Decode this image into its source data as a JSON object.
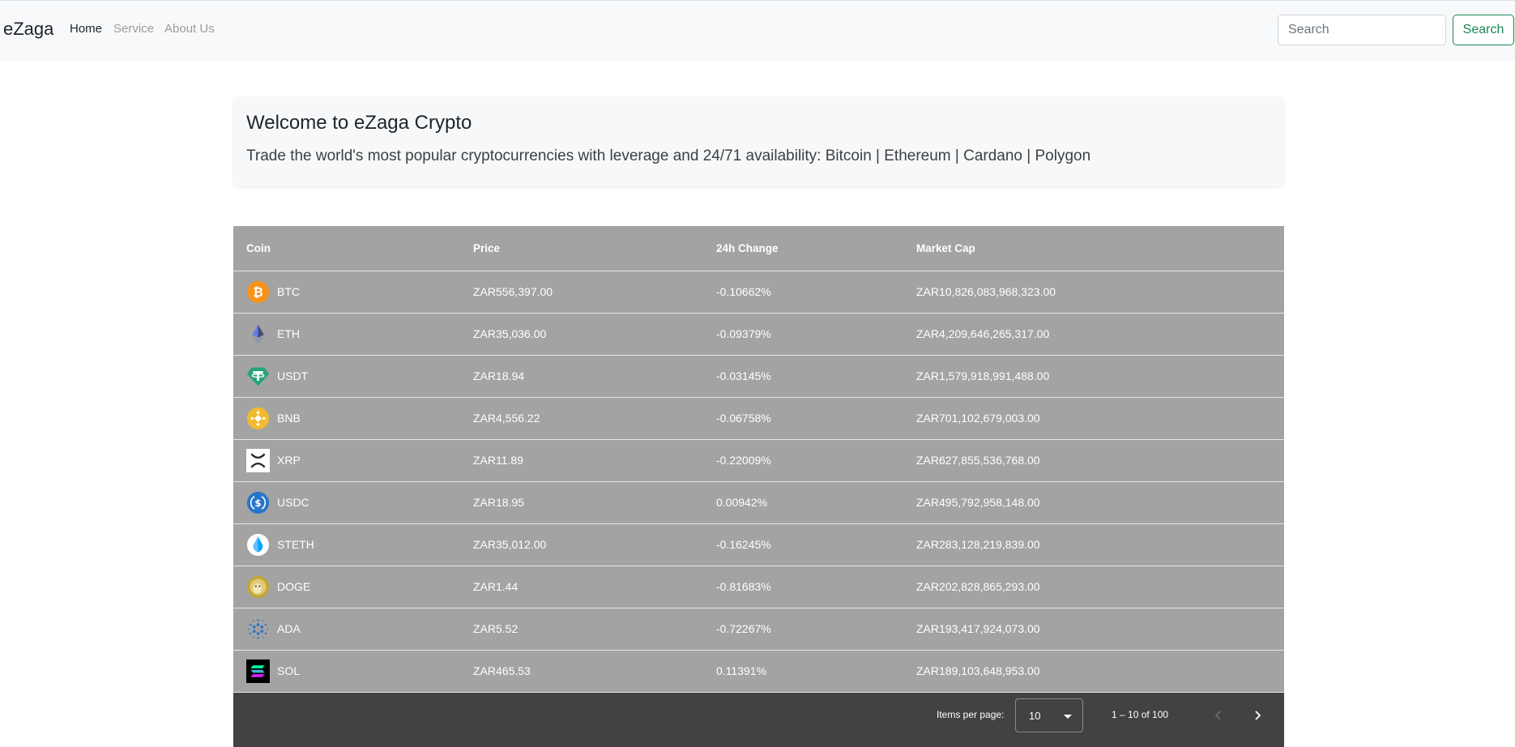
{
  "nav": {
    "brand": "eZaga",
    "links": [
      "Home",
      "Service",
      "About Us"
    ],
    "search_placeholder": "Search",
    "search_button": "Search"
  },
  "welcome": {
    "title": "Welcome to eZaga Crypto",
    "subtitle": "Trade the world's most popular cryptocurrencies with leverage and 24/71 availability: Bitcoin | Ethereum | Cardano | Polygon"
  },
  "table": {
    "headers": [
      "Coin",
      "Price",
      "24h Change",
      "Market Cap"
    ],
    "rows": [
      {
        "symbol": "BTC",
        "price": "ZAR556,397.00",
        "change": "-0.10662%",
        "market_cap": "ZAR10,826,083,968,323.00",
        "icon": "bitcoin-icon"
      },
      {
        "symbol": "ETH",
        "price": "ZAR35,036.00",
        "change": "-0.09379%",
        "market_cap": "ZAR4,209,646,265,317.00",
        "icon": "ethereum-icon"
      },
      {
        "symbol": "USDT",
        "price": "ZAR18.94",
        "change": "-0.03145%",
        "market_cap": "ZAR1,579,918,991,488.00",
        "icon": "tether-icon"
      },
      {
        "symbol": "BNB",
        "price": "ZAR4,556.22",
        "change": "-0.06758%",
        "market_cap": "ZAR701,102,679,003.00",
        "icon": "bnb-icon"
      },
      {
        "symbol": "XRP",
        "price": "ZAR11.89",
        "change": "-0.22009%",
        "market_cap": "ZAR627,855,536,768.00",
        "icon": "xrp-icon"
      },
      {
        "symbol": "USDC",
        "price": "ZAR18.95",
        "change": "0.00942%",
        "market_cap": "ZAR495,792,958,148.00",
        "icon": "usdc-icon"
      },
      {
        "symbol": "STETH",
        "price": "ZAR35,012.00",
        "change": "-0.16245%",
        "market_cap": "ZAR283,128,219,839.00",
        "icon": "steth-icon"
      },
      {
        "symbol": "DOGE",
        "price": "ZAR1.44",
        "change": "-0.81683%",
        "market_cap": "ZAR202,828,865,293.00",
        "icon": "dogecoin-icon"
      },
      {
        "symbol": "ADA",
        "price": "ZAR5.52",
        "change": "-0.72267%",
        "market_cap": "ZAR193,417,924,073.00",
        "icon": "cardano-icon"
      },
      {
        "symbol": "SOL",
        "price": "ZAR465.53",
        "change": "0.11391%",
        "market_cap": "ZAR189,103,648,953.00",
        "icon": "solana-icon"
      }
    ]
  },
  "paginator": {
    "items_label": "Items per page:",
    "page_size": "10",
    "range": "1 – 10 of 100"
  },
  "colors": {
    "table_bg": "#a3a3a3",
    "paginator_bg": "#424242",
    "search_button": "#198754",
    "btc": "#f7931a",
    "eth": "#627eea",
    "usdt": "#26a17b",
    "bnb": "#f3ba2f",
    "usdc": "#2775ca",
    "steth": "#00a3ff",
    "doge": "#c2a633",
    "ada": "#2a71d0"
  }
}
